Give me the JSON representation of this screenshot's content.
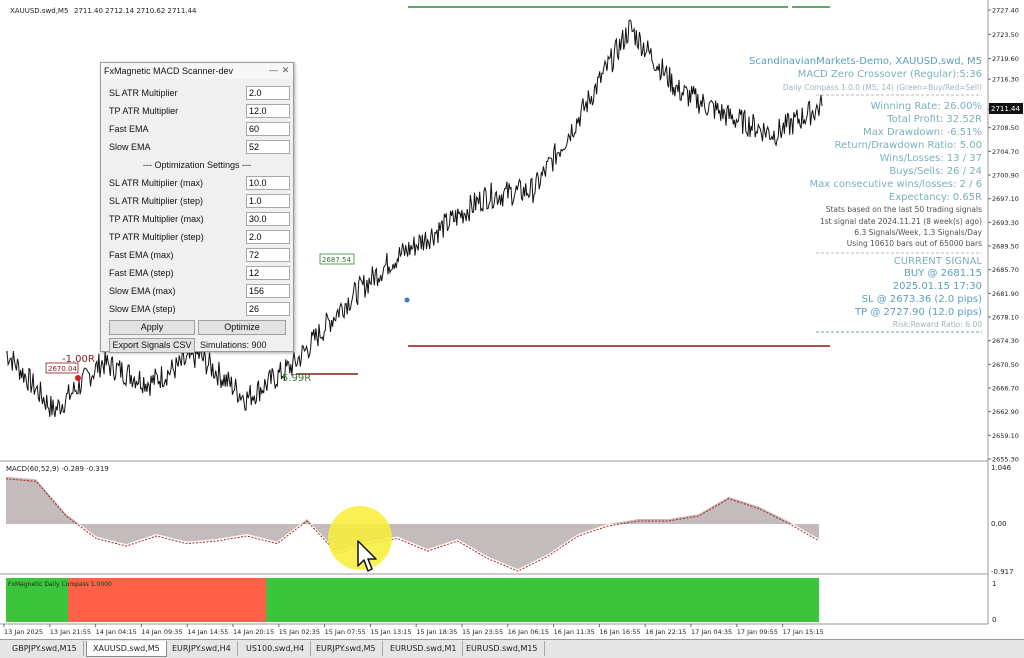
{
  "window": {
    "symbol_header": "XAUUSD.swd,M5",
    "ohlc": "2711.40 2712.14 2710.62 2711.44"
  },
  "price_axis": {
    "labels": [
      "2727.40",
      "2723.50",
      "2719.60",
      "2716.30",
      "2711.44",
      "2708.50",
      "2704.70",
      "2700.90",
      "2697.10",
      "2693.30",
      "2689.50",
      "2685.70",
      "2681.90",
      "2678.10",
      "2674.30",
      "2670.50",
      "2666.70",
      "2662.90",
      "2659.10",
      "2655.30"
    ],
    "current_price": "2711.44"
  },
  "macd": {
    "header": "MACD(60,52,9) -0.289 -0.319",
    "axis_labels": [
      "1.046",
      "0.00",
      "-0.917"
    ]
  },
  "compass": {
    "header": "FxMagnetic Daily Compass 1.0000",
    "axis_labels": [
      "1",
      "0"
    ],
    "colors": {
      "green": "#3cc43c",
      "red": "#ff6048"
    }
  },
  "time_axis": {
    "labels": [
      "13 Jan 2025",
      "13 Jan 21:55",
      "14 Jan 04:15",
      "14 Jan 09:35",
      "14 Jan 14:55",
      "14 Jan 20:15",
      "15 Jan 02:35",
      "15 Jan 07:55",
      "15 Jan 13:15",
      "15 Jan 18:35",
      "15 Jan 23:55",
      "16 Jan 06:15",
      "16 Jan 11:35",
      "16 Jan 16:55",
      "16 Jan 22:15",
      "17 Jan 04:35",
      "17 Jan 09:55",
      "17 Jan 15:15"
    ]
  },
  "annotations": {
    "loss_label": "-1.00R",
    "entry_label_1": "2670.04",
    "entry_label_2": "2687.54",
    "gain_label": "5.99R"
  },
  "dialog": {
    "title": "FxMagnetic MACD Scanner-dev",
    "minimize_glyph": "—",
    "close_glyph": "✕",
    "params": [
      {
        "label": "SL ATR Multiplier",
        "value": "2.0"
      },
      {
        "label": "TP ATR Multiplier",
        "value": "12.0"
      },
      {
        "label": "Fast EMA",
        "value": "60"
      },
      {
        "label": "Slow EMA",
        "value": "52"
      }
    ],
    "optimization_header": "--- Optimization Settings ---",
    "opt_params": [
      {
        "label": "SL ATR Multiplier (max)",
        "value": "10.0"
      },
      {
        "label": "SL ATR Multiplier (step)",
        "value": "1.0"
      },
      {
        "label": "TP ATR Multiplier (max)",
        "value": "30.0"
      },
      {
        "label": "TP ATR Multiplier (step)",
        "value": "2.0"
      },
      {
        "label": "Fast EMA (max)",
        "value": "72"
      },
      {
        "label": "Fast EMA (step)",
        "value": "12"
      },
      {
        "label": "Slow EMA (max)",
        "value": "156"
      },
      {
        "label": "Slow EMA (step)",
        "value": "26"
      }
    ],
    "apply_label": "Apply",
    "optimize_label": "Optimize",
    "export_label": "Export Signals CSV",
    "simulations": "Simulations: 900"
  },
  "stats": {
    "account": "ScandinavianMarkets-Demo, XAUUSD.swd, M5",
    "strategy": "MACD Zero Crossover (Regular):5:36",
    "compass": "Daily Compass 1.0.0 (M5, 14) (Green=Buy/Red=Sell)",
    "winning_rate": "Winning Rate: 26.00%",
    "total_profit": "Total Profit: 32.52R",
    "max_drawdown": "Max Drawdown: -6.51%",
    "return_dd": "Return/Drawdown Ratio: 5.00",
    "wins_losses": "Wins/Losses: 13 / 37",
    "buys_sells": "Buys/Sells: 26 / 24",
    "max_consecutive": "Max consecutive wins/losses: 2 / 6",
    "expectancy": "Expectancy: 0.65R",
    "stats_based": "Stats based on the last 50 trading signals",
    "first_signal": "1st signal date 2024.11.21 (8 week(s) ago)",
    "signals_rate": "6.3 Signals/Week,    1.3 Signals/Day",
    "bars_used": "Using 10610 bars out of 65000 bars",
    "current_signal": "CURRENT SIGNAL",
    "signal": "BUY @ 2681.15",
    "signal_time": "2025.01.15 17:30",
    "sl": "SL @ 2673.36 (2.0 pips)",
    "tp": "TP @ 2727.90 (12.0 pips)",
    "rr": "Risk:Reward Ratio: 6.00"
  },
  "tabs": [
    {
      "label": "GBPJPY.swd,M15",
      "active": false
    },
    {
      "label": "XAUUSD.swd,M5",
      "active": true
    },
    {
      "label": "EURJPY.swd,H4",
      "active": false
    },
    {
      "label": "US100.swd,H4",
      "active": false
    },
    {
      "label": "EURJPY.swd,M5",
      "active": false
    },
    {
      "label": "EURUSD.swd,M1",
      "active": false
    },
    {
      "label": "EURUSD.swd,M15",
      "active": false
    }
  ],
  "chart_data": {
    "type": "line",
    "x": [
      "13 Jan 2025",
      "13 Jan 21:55",
      "14 Jan 04:15",
      "14 Jan 09:35",
      "14 Jan 14:55",
      "14 Jan 20:15",
      "15 Jan 02:35",
      "15 Jan 07:55",
      "15 Jan 13:15",
      "15 Jan 18:35",
      "15 Jan 23:55",
      "16 Jan 06:15",
      "16 Jan 11:35",
      "16 Jan 16:55",
      "16 Jan 22:15",
      "17 Jan 04:35",
      "17 Jan 09:55",
      "17 Jan 15:15"
    ],
    "series": [
      {
        "values": [
          2672.5,
          2663.0,
          2670.8,
          2667.5,
          2672.0,
          2665.0,
          2670.5,
          2679.8,
          2687.0,
          2692.0,
          2697.5,
          2698.5,
          2711.0,
          2724.5,
          2714.5,
          2710.5,
          2707.5,
          2712.0
        ]
      }
    ],
    "ylim": [
      2655.3,
      2727.4
    ]
  }
}
